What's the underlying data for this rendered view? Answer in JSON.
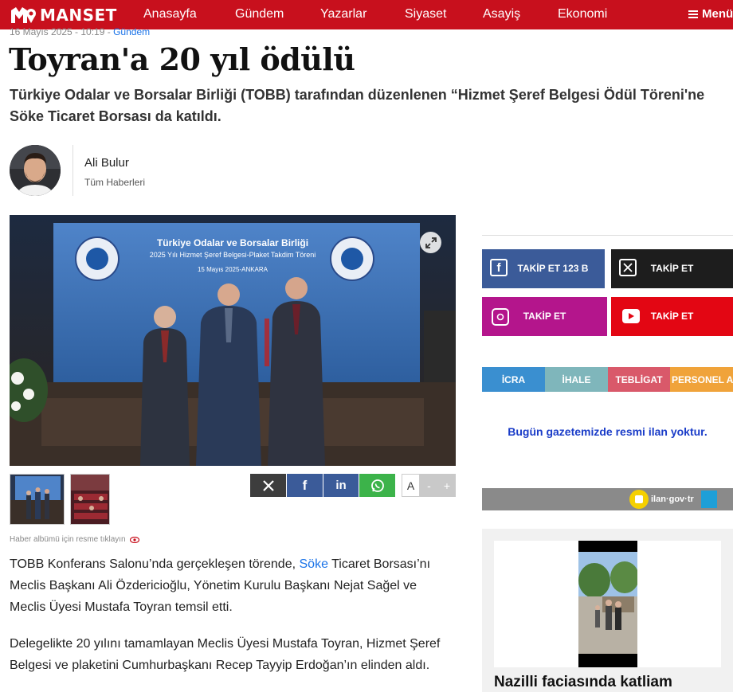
{
  "brand": {
    "name": "MANSET",
    "accent": "#c8101d"
  },
  "nav": {
    "items": [
      {
        "label": "Anasayfa",
        "key": "home"
      },
      {
        "label": "Gündem",
        "key": "gundem"
      },
      {
        "label": "Yazarlar",
        "key": "yazarlar"
      },
      {
        "label": "Siyaset",
        "key": "siyaset"
      },
      {
        "label": "Asayiş",
        "key": "asayis"
      },
      {
        "label": "Ekonomi",
        "key": "ekonomi"
      }
    ],
    "menu_label": "Menü"
  },
  "article": {
    "dateline": "16 Mayıs 2025 - 10:19",
    "category": "Gündem",
    "title": "Toyran'a 20 yıl ödülü",
    "summary": "Türkiye Odalar ve Borsalar Birliği (TOBB) tarafından düzenlenen “Hizmet Şeref Belgesi Ödül Töreni'ne Söke Ticaret Borsası da katıldı.",
    "author": {
      "name": "Ali Bulur",
      "all_news": "Tüm Haberleri"
    },
    "photo": {
      "banner_line1": "Türkiye Odalar ve Borsalar Birliği",
      "banner_line2": "2025 Yılı Hizmet Şeref Belgesi-Plaket Takdim Töreni",
      "banner_line3": "15 Mayıs 2025-ANKARA"
    },
    "album_note": "Haber albümü için resme tıklayın",
    "paragraph1_a": "TOBB Konferans Salonu’nda gerçekleşen törende, ",
    "paragraph1_link": "Söke",
    "paragraph1_b": " Ticaret Borsası’nı Meclis Başkanı Ali Özdericioğlu, Yönetim Kurulu Başkanı Nejat Sağel ve Meclis Üyesi Mustafa Toyran temsil etti.",
    "paragraph2": "Delegelikte 20 yılını tamamlayan Meclis Üyesi Mustafa Toyran, Hizmet Şeref Belgesi ve plaketini Cumhurbaşkanı Recep Tayyip Erdoğan’ın elinden aldı."
  },
  "share": {
    "font_a": "A",
    "font_minus": "-",
    "font_plus": "+",
    "colors": {
      "x": "#3d3d3d",
      "facebook": "#3b5b99",
      "linkedin": "#3b5b99",
      "whatsapp": "#3cb34a"
    }
  },
  "sidebar": {
    "social": [
      {
        "key": "facebook",
        "label": "TAKİP ET 123 B",
        "color": "#3b5b99",
        "icon": "facebook-icon"
      },
      {
        "key": "x",
        "label": "TAKİP ET",
        "color": "#1d1d1d",
        "icon": "x-icon"
      },
      {
        "key": "instagram",
        "label": "TAKİP ET",
        "color": "#b4158c",
        "icon": "instagram-icon"
      },
      {
        "key": "youtube",
        "label": "TAKİP ET",
        "color": "#e30613",
        "icon": "youtube-icon"
      }
    ],
    "tabs": [
      {
        "label": "İCRA",
        "color": "#3a8fd0"
      },
      {
        "label": "İHALE",
        "color": "#7fb6bb"
      },
      {
        "label": "TEBLİGAT",
        "color": "#d9596a"
      },
      {
        "label": "PERSONEL ALIMI",
        "color": "#f0a33a"
      }
    ],
    "ilan_message": "Bugün gazetemizde resmi ilan yoktur.",
    "ilan_logo": "ilan·gov·tr",
    "news_title": "Nazilli faciasında katliam"
  }
}
